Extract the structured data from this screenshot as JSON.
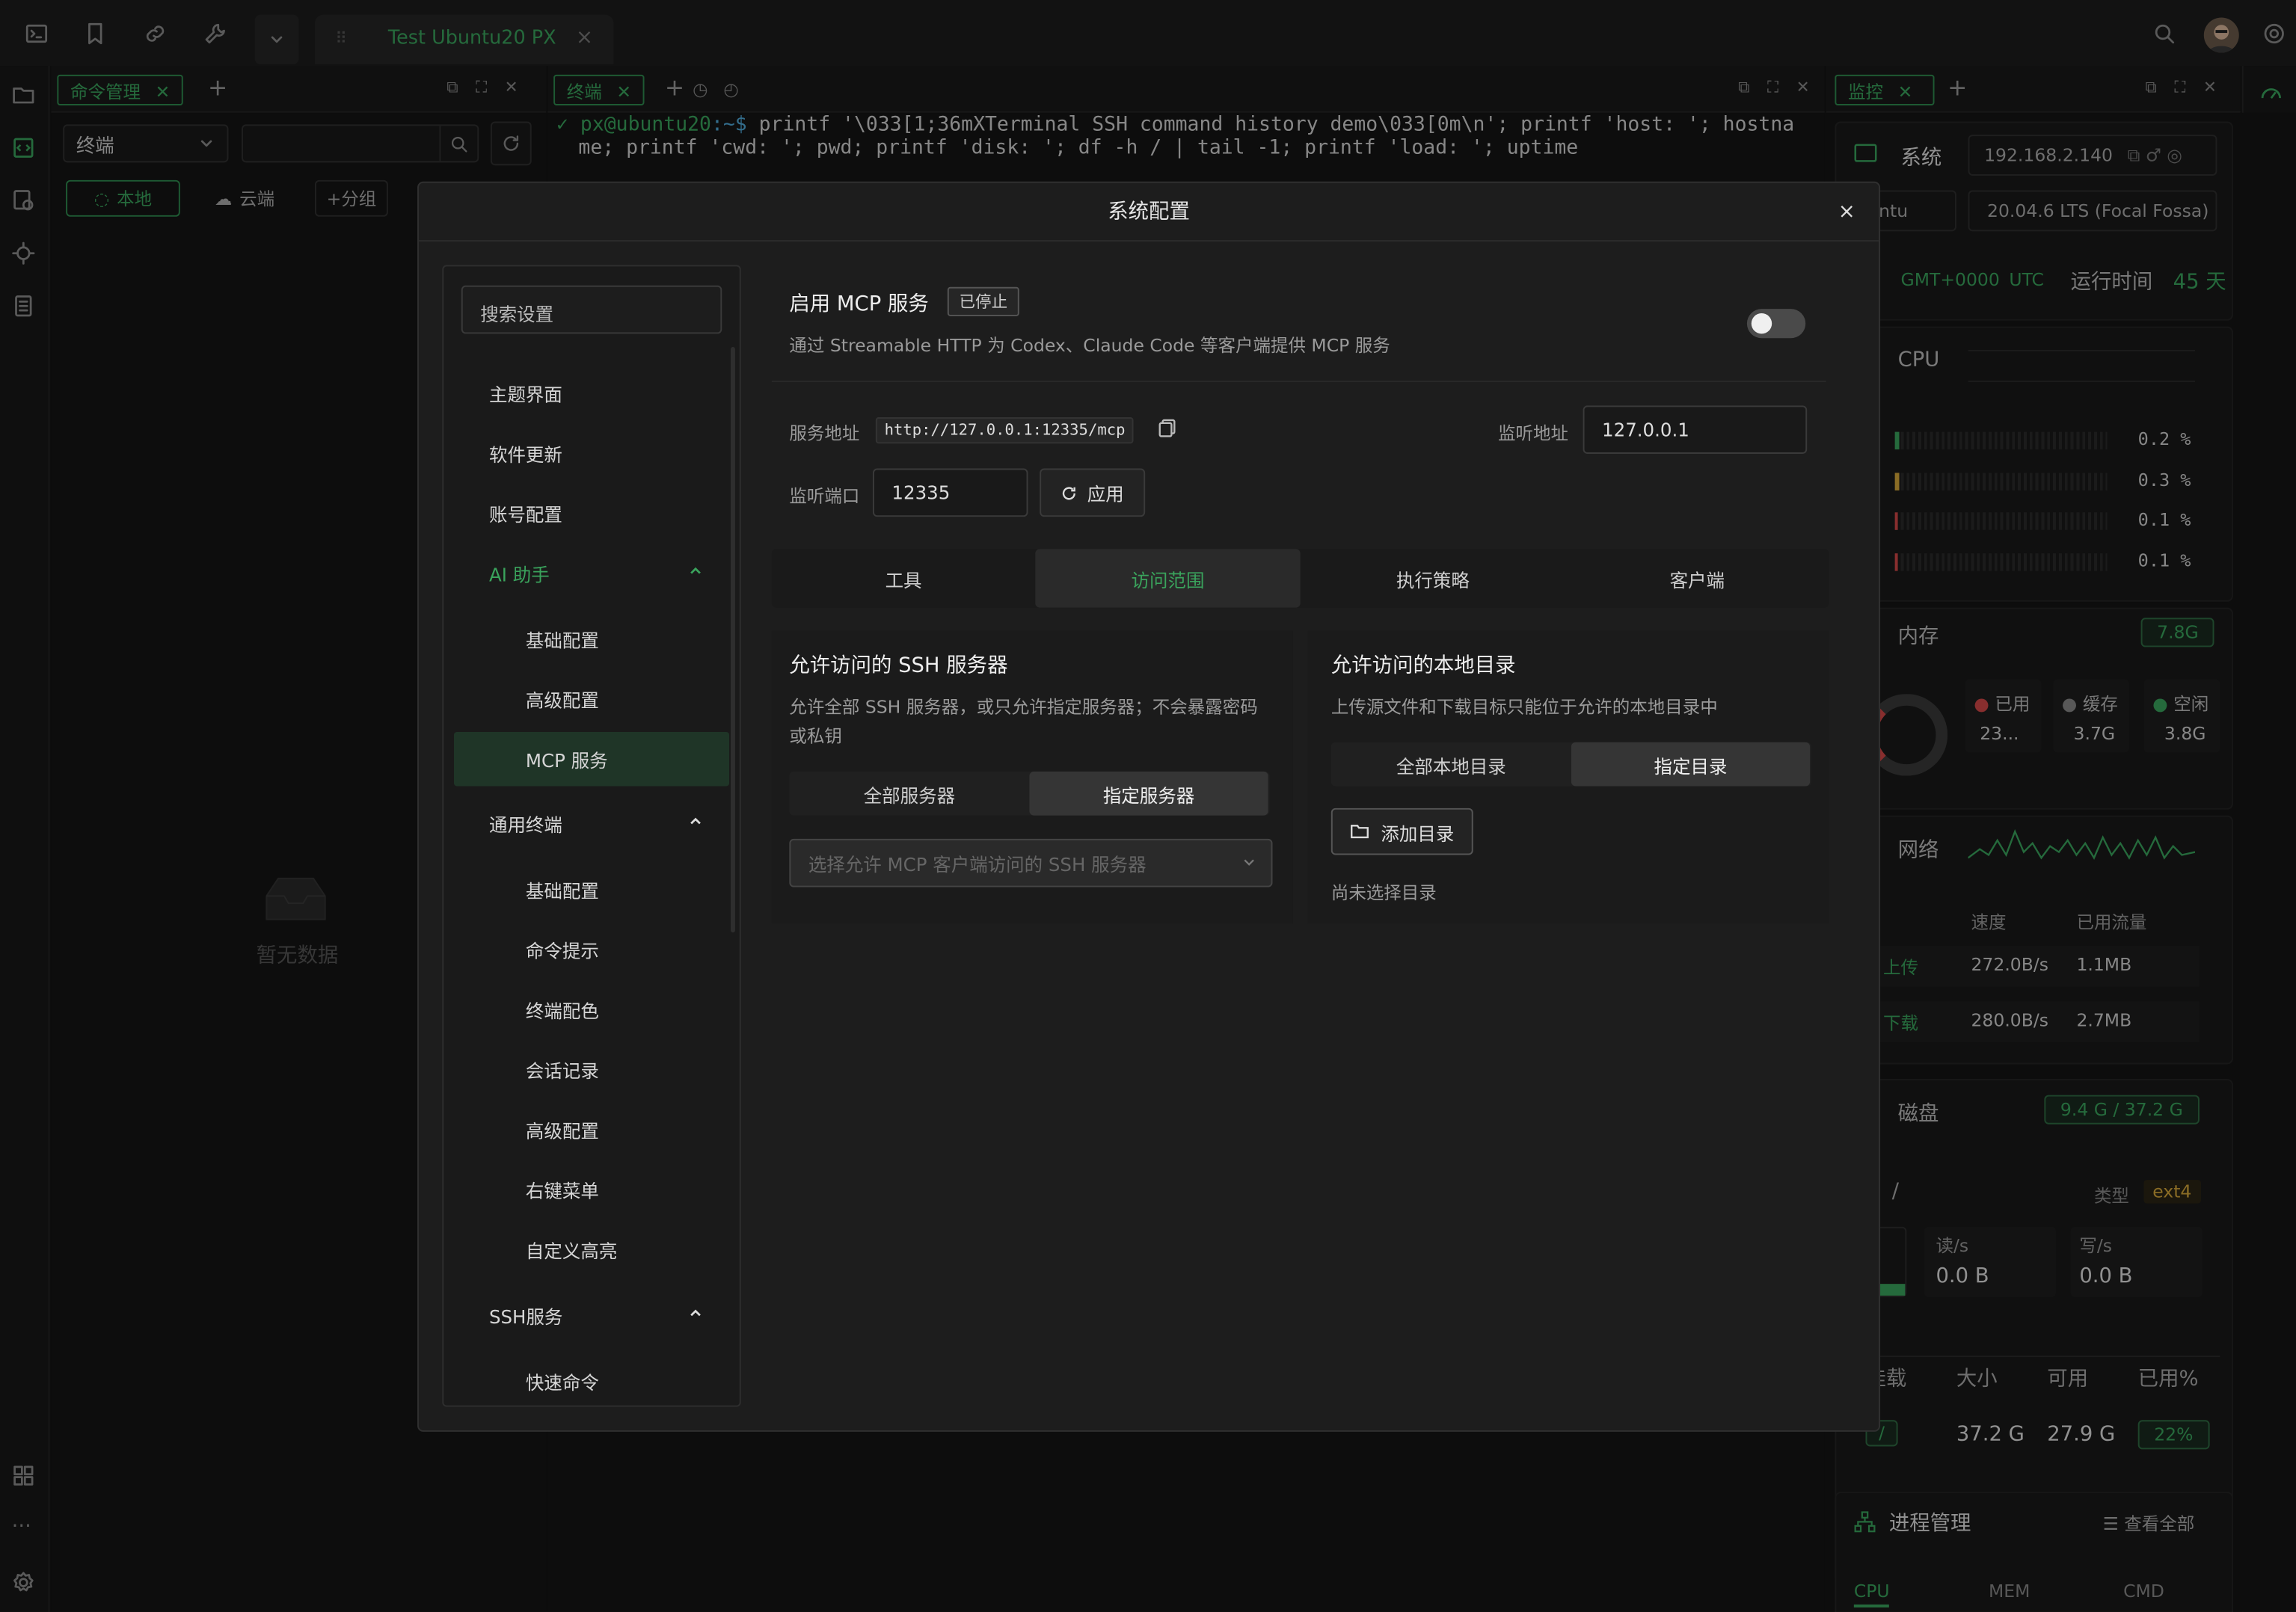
{
  "topbar": {
    "tab_label": "Test Ubuntu20 PX",
    "tab_close": "×"
  },
  "left_panel": {
    "tab_label": "命令管理",
    "add": "+",
    "select_value": "终端",
    "chips": [
      "本地",
      "云端",
      "+分组"
    ],
    "empty": "暂无数据"
  },
  "terminal": {
    "tab_label": "终端",
    "prompt_user": "px@ubuntu20",
    "prompt_path": ":~$",
    "line1": " printf '\\033[1;36mXTerminal SSH command history demo\\033[0m\\n'; printf 'host: '; hostna",
    "line2": "me; printf 'cwd: '; pwd; printf 'disk: '; df -h / | tail -1; printf 'load: '; uptime"
  },
  "monitor": {
    "tab_label": "监控",
    "system_label": "系统",
    "ip": "192.168.2.140",
    "os": "Ubuntu",
    "version": "20.04.6 LTS (Focal Fossa)",
    "tz": "GMT+0000",
    "utc": "UTC",
    "uptime_label": "运行时间",
    "uptime_value": "45 天",
    "cpu_label": "CPU",
    "cpu_cores": [
      "0.2 %",
      "0.3 %",
      "0.1 %",
      "0.1 %"
    ],
    "mem_label": "内存",
    "mem_total": "7.8G",
    "mem_used_label": "已用",
    "mem_used": "23...",
    "mem_cache_label": "缓存",
    "mem_cache": "3.7G",
    "mem_free_label": "空闲",
    "mem_free": "3.8G",
    "net_label": "网络",
    "net_speed_h": "速度",
    "net_used_h": "已用流量",
    "up_label": "上传",
    "up_speed": "272.0B/s",
    "up_used": "1.1MB",
    "down_label": "下载",
    "down_speed": "280.0B/s",
    "down_used": "2.7MB",
    "disk_label": "磁盘",
    "disk_total": "9.4 G / 37.2 G",
    "mount": "/",
    "type_label": "类型",
    "type_value": "ext4",
    "read_label": "读/s",
    "read_value": "0.0 B",
    "write_label": "写/s",
    "write_value": "0.0 B",
    "th_mount": "挂载",
    "th_size": "大小",
    "th_avail": "可用",
    "th_pct": "已用%",
    "row_mount": "/",
    "row_size": "37.2 G",
    "row_avail": "27.9 G",
    "row_pct": "22%",
    "proc_label": "进程管理",
    "proc_view_all": "查看全部",
    "proc_tabs": [
      "CPU",
      "MEM",
      "CMD"
    ]
  },
  "modal": {
    "title": "系统配置",
    "close": "×",
    "search_placeholder": "搜索设置",
    "nav": [
      {
        "label": "主题界面"
      },
      {
        "label": "软件更新"
      },
      {
        "label": "账号配置"
      },
      {
        "label": "AI 助手"
      },
      {
        "label": "基础配置"
      },
      {
        "label": "高级配置"
      },
      {
        "label": "MCP 服务"
      },
      {
        "label": "通用终端"
      },
      {
        "label": "基础配置"
      },
      {
        "label": "命令提示"
      },
      {
        "label": "终端配色"
      },
      {
        "label": "会话记录"
      },
      {
        "label": "高级配置"
      },
      {
        "label": "右键菜单"
      },
      {
        "label": "自定义高亮"
      },
      {
        "label": "SSH服务"
      },
      {
        "label": "快速命令"
      }
    ],
    "mcp_title": "启用 MCP 服务",
    "mcp_status": "已停止",
    "mcp_desc": "通过 Streamable HTTP 为 Codex、Claude Code 等客户端提供 MCP 服务",
    "service_addr_label": "服务地址",
    "service_addr": "http://127.0.0.1:12335/mcp",
    "listen_addr_label": "监听地址",
    "listen_addr": "127.0.0.1",
    "listen_port_label": "监听端口",
    "listen_port": "12335",
    "apply": "应用",
    "tabs": [
      "工具",
      "访问范围",
      "执行策略",
      "客户端"
    ],
    "ssh_title": "允许访问的 SSH 服务器",
    "ssh_desc1": "允许全部 SSH 服务器，或只允许指定服务器；不会暴露密码",
    "ssh_desc2": "或私钥",
    "ssh_all": "全部服务器",
    "ssh_specific": "指定服务器",
    "ssh_select_placeholder": "选择允许 MCP 客户端访问的 SSH 服务器",
    "dir_title": "允许访问的本地目录",
    "dir_desc": "上传源文件和下载目标只能位于允许的本地目录中",
    "dir_all": "全部本地目录",
    "dir_specific": "指定目录",
    "add_dir": "添加目录",
    "no_dir": "尚未选择目录"
  },
  "colors": {
    "accent": "#3aa35c",
    "active_nav_bg": "#1f3527"
  }
}
